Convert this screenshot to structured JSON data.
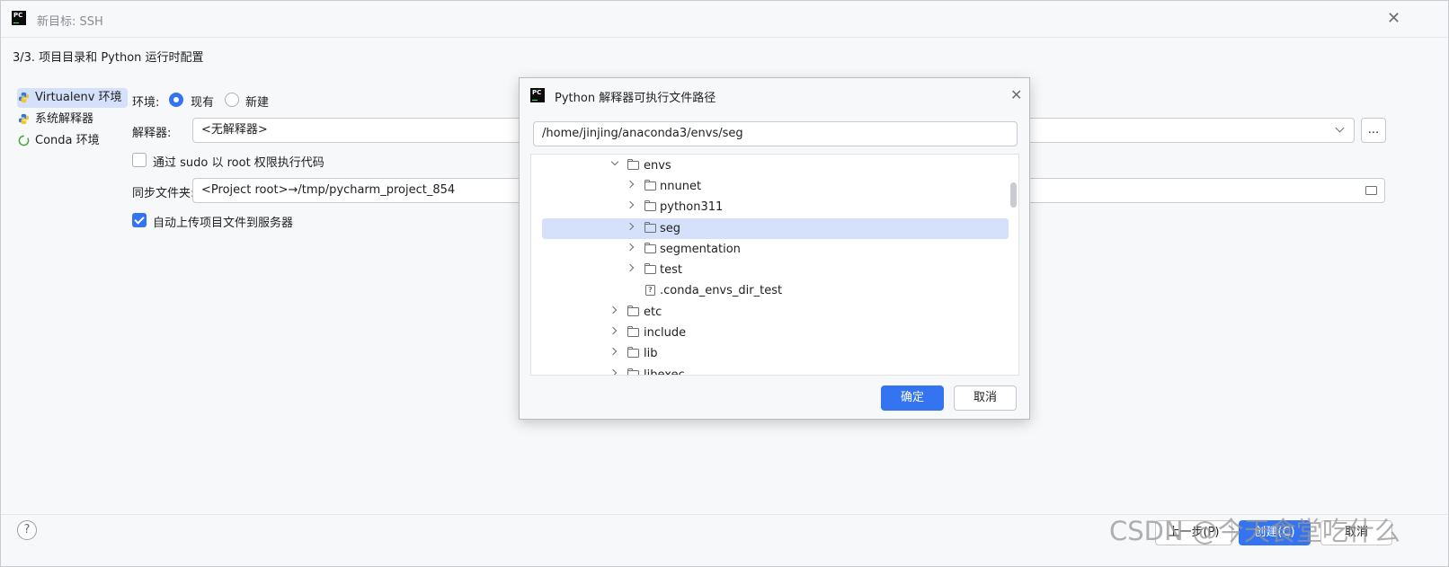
{
  "window": {
    "title": "新目标: SSH",
    "step": "3/3. 项目目录和 Python 运行时配置"
  },
  "sidebar": {
    "items": [
      {
        "label": "Virtualenv 环境",
        "selected": true,
        "icon": "virtualenv-icon"
      },
      {
        "label": "系统解释器",
        "selected": false,
        "icon": "python-icon"
      },
      {
        "label": "Conda 环境",
        "selected": false,
        "icon": "conda-icon"
      }
    ]
  },
  "form": {
    "env_label": "环境:",
    "env_existing": "现有",
    "env_new": "新建",
    "interpreter_label": "解释器:",
    "interpreter_value": "<无解释器>",
    "browse_label": "...",
    "sudo_label": "通过 sudo 以 root 权限执行代码",
    "sudo_checked": false,
    "sync_label": "同步文件夹:",
    "sync_value": "<Project root>→/tmp/pycharm_project_854",
    "upload_label": "自动上传项目文件到服务器",
    "upload_checked": true
  },
  "footer": {
    "help": "?",
    "prev": "上一步(P)",
    "create": "创建(C)",
    "cancel": "取消"
  },
  "watermark": "CSDN @今天食堂吃什么",
  "dialog": {
    "title": "Python 解释器可执行文件路径",
    "path": "/home/jinjing/anaconda3/envs/seg",
    "ok": "确定",
    "cancel": "取消",
    "tree": [
      {
        "label": "envs",
        "depth": 0,
        "expanded": true,
        "type": "folder"
      },
      {
        "label": "nnunet",
        "depth": 1,
        "expanded": false,
        "type": "folder"
      },
      {
        "label": "python311",
        "depth": 1,
        "expanded": false,
        "type": "folder"
      },
      {
        "label": "seg",
        "depth": 1,
        "expanded": false,
        "type": "folder",
        "selected": true
      },
      {
        "label": "segmentation",
        "depth": 1,
        "expanded": false,
        "type": "folder"
      },
      {
        "label": "test",
        "depth": 1,
        "expanded": false,
        "type": "folder"
      },
      {
        "label": ".conda_envs_dir_test",
        "depth": 1,
        "type": "file"
      },
      {
        "label": "etc",
        "depth": 0,
        "expanded": false,
        "type": "folder"
      },
      {
        "label": "include",
        "depth": 0,
        "expanded": false,
        "type": "folder"
      },
      {
        "label": "lib",
        "depth": 0,
        "expanded": false,
        "type": "folder"
      },
      {
        "label": "libexec",
        "depth": 0,
        "expanded": false,
        "type": "folder"
      }
    ]
  },
  "colors": {
    "accent": "#3574f0",
    "selection": "#d5e1fb"
  }
}
